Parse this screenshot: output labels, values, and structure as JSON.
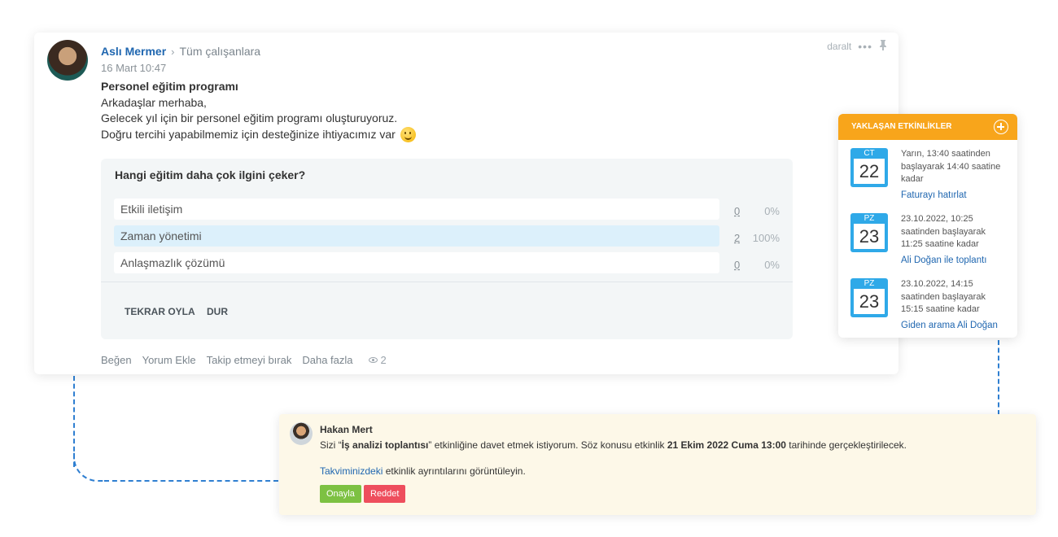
{
  "post": {
    "author": "Aslı Mermer",
    "recipients": "Tüm çalışanlara",
    "date": "16 Mart 10:47",
    "collapse_label": "daralt",
    "title": "Personel eğitim programı",
    "lines": [
      "Arkadaşlar merhaba,",
      "Gelecek yıl için bir personel eğitim programı oluşturuyoruz.",
      "Doğru tercihi yapabilmemiz için desteğinize ihtiyacımız var"
    ],
    "poll": {
      "question": "Hangi eğitim daha çok ilgini çeker?",
      "options": [
        {
          "label": "Etkili iletişim",
          "count": "0",
          "percent": "0%",
          "selected": false
        },
        {
          "label": "Zaman yönetimi",
          "count": "2",
          "percent": "100%",
          "selected": true
        },
        {
          "label": "Anlaşmazlık çözümü",
          "count": "0",
          "percent": "0%",
          "selected": false
        }
      ],
      "revote_label": "TEKRAR OYLA",
      "stop_label": "DUR"
    },
    "footer": {
      "like": "Beğen",
      "comment": "Yorum Ekle",
      "unfollow": "Takip etmeyi bırak",
      "more": "Daha fazla",
      "views": "2"
    }
  },
  "events": {
    "title": "YAKLAŞAN ETKİNLİKLER",
    "items": [
      {
        "day": "CT",
        "num": "22",
        "time": "Yarın, 13:40 saatinden başlayarak 14:40 saatine kadar",
        "name": "Faturayı hatırlat"
      },
      {
        "day": "PZ",
        "num": "23",
        "time": "23.10.2022, 10:25 saatinden başlayarak 11:25 saatine kadar",
        "name": "Ali Doğan ile toplantı"
      },
      {
        "day": "PZ",
        "num": "23",
        "time": "23.10.2022, 14:15 saatinden başlayarak 15:15 saatine kadar",
        "name": "Giden arama Ali Doğan"
      }
    ]
  },
  "invite": {
    "sender": "Hakan Mert",
    "text_before": "Sizi “",
    "event_name": "İş analizi toplantısı",
    "text_middle": "” etkinliğine davet etmek istiyorum. Söz konusu etkinlik ",
    "event_date": "21 Ekim 2022 Cuma 13:00",
    "text_after": " tarihinde gerçekleştirilecek.",
    "calendar_link": "Takviminizdeki",
    "calendar_text": " etkinlik ayrıntılarını görüntüleyin.",
    "accept_label": "Onayla",
    "decline_label": "Reddet"
  }
}
